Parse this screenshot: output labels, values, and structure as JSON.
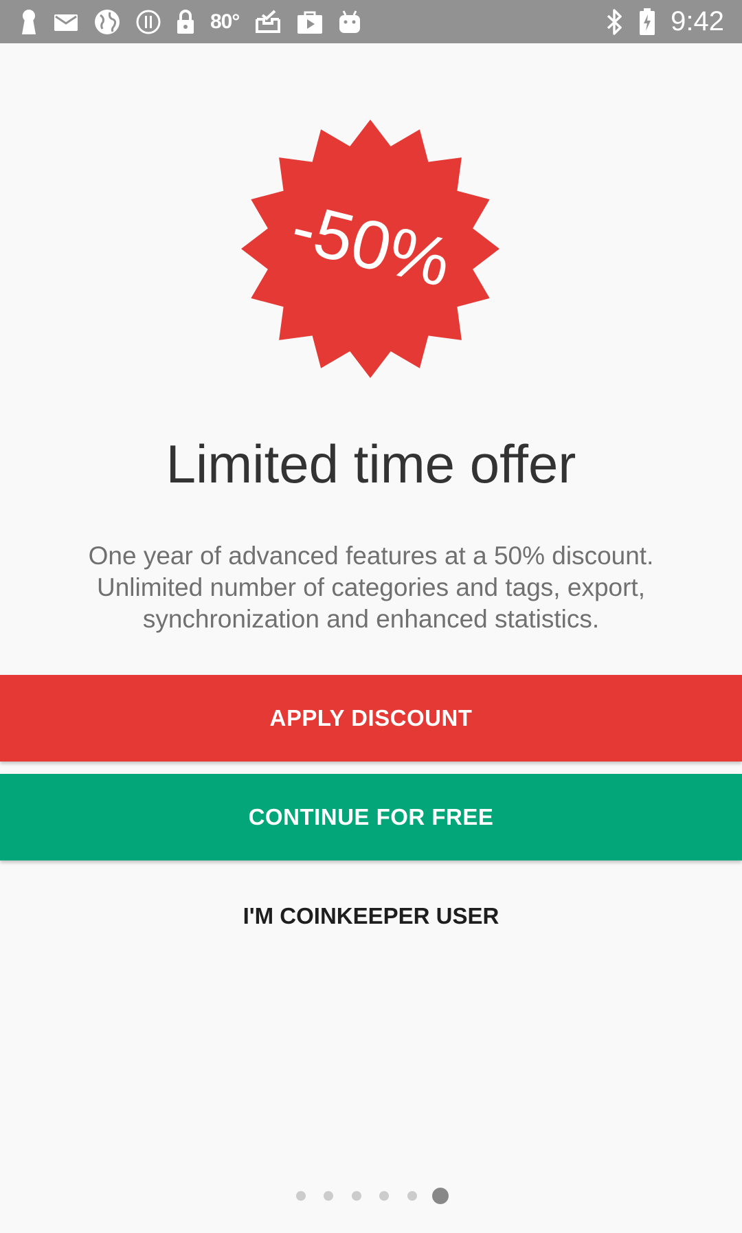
{
  "status_bar": {
    "temperature": "80°",
    "time": "9:42",
    "left_icons": [
      "keyhole-icon",
      "mail-icon",
      "globe-icon",
      "alert-icon",
      "lock-icon",
      "temperature-icon",
      "inbox-check-icon",
      "play-bag-icon",
      "android-icon"
    ],
    "right_icons": [
      "bluetooth-icon",
      "battery-icon",
      "clock-time"
    ]
  },
  "promo": {
    "badge_text": "-50%",
    "badge_color": "#e53935",
    "title": "Limited time offer",
    "description_lines": [
      "One year of advanced features at a 50% discount.",
      "Unlimited number of categories and tags, export,",
      "synchronization and enhanced statistics."
    ]
  },
  "actions": {
    "apply_discount": "APPLY DISCOUNT",
    "continue_free": "CONTINUE FOR FREE",
    "coinkeeper_user": "I'M COINKEEPER USER"
  },
  "colors": {
    "discount_button": "#e53935",
    "free_button": "#03a678",
    "background": "#f9f9f9"
  },
  "pager": {
    "total_pages": 6,
    "active_page": 6
  }
}
